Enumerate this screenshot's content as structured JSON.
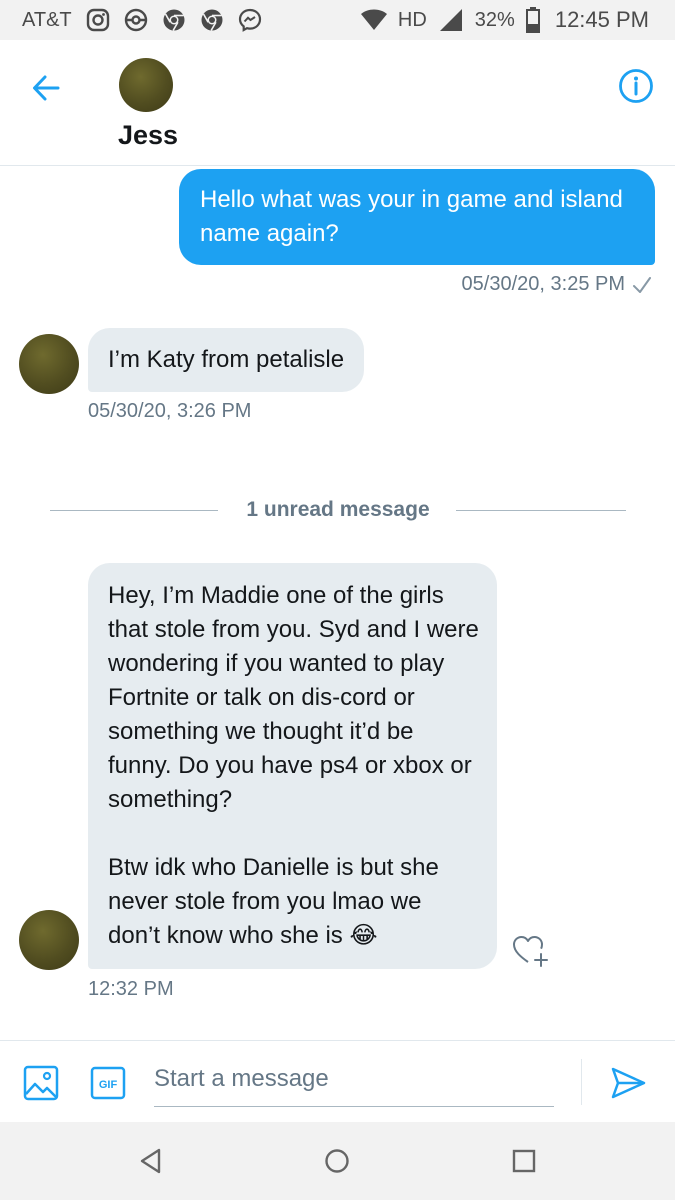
{
  "status_bar": {
    "carrier": "AT&T",
    "network": "HD",
    "battery": "32%",
    "time": "12:45 PM",
    "icons": [
      "instagram-icon",
      "pokeball-icon",
      "chrome-icon",
      "chrome-icon",
      "messenger-icon",
      "wifi-icon",
      "signal-icon",
      "battery-icon"
    ]
  },
  "header": {
    "name": "Jess",
    "back_icon": "arrow-left-icon",
    "info_icon": "info-circle-icon"
  },
  "messages": [
    {
      "direction": "outgoing",
      "text": "Hello what was your in game and island name again?",
      "time": "05/30/20, 3:25 PM",
      "status_icon": "checkmark-icon"
    },
    {
      "direction": "incoming",
      "text": "I’m Katy from petalisle",
      "time": "05/30/20, 3:26 PM"
    },
    {
      "direction": "incoming",
      "paragraphs": [
        "Hey, I’m Maddie one of the girls that stole from you. Syd and I were wondering if you wanted to play Fortnite or talk on dis-cord or something we thought it’d be funny. Do you have ps4 or xbox or something?",
        "Btw idk who Danielle is but she never stole from you lmao we don’t know who she is 😂"
      ],
      "time": "12:32 PM"
    }
  ],
  "unread_divider": "1 unread message",
  "composer": {
    "placeholder": "Start a message",
    "gif_label": "GIF"
  },
  "colors": {
    "accent": "#1da1f2",
    "bubble_incoming": "#e6ecf0",
    "secondary_text": "#657786"
  }
}
